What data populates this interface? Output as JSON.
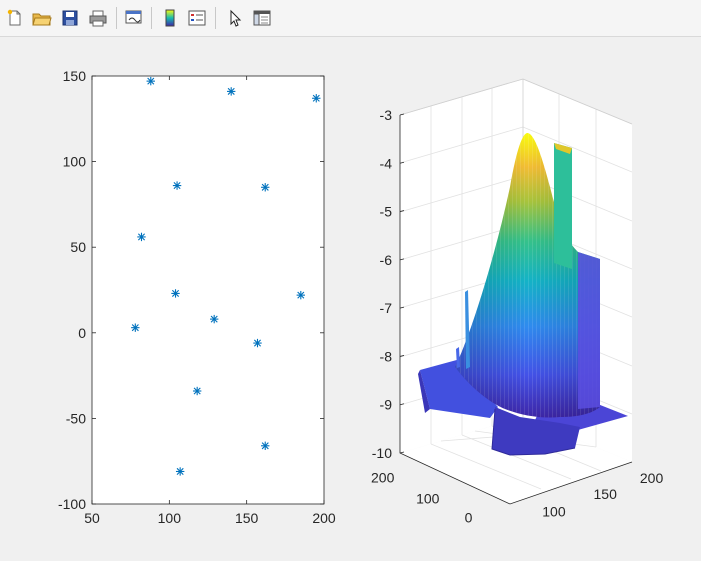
{
  "toolbar": {
    "items": [
      {
        "name": "new-figure-icon"
      },
      {
        "name": "open-file-icon"
      },
      {
        "name": "save-icon"
      },
      {
        "name": "print-icon"
      },
      {
        "name": "link-plot-icon"
      },
      {
        "name": "insert-colorbar-icon"
      },
      {
        "name": "insert-legend-icon"
      },
      {
        "name": "edit-plot-icon"
      },
      {
        "name": "property-inspector-icon"
      }
    ]
  },
  "chart_data": [
    {
      "type": "scatter",
      "marker": "asterisk",
      "color": "#0072BD",
      "xlim": [
        50,
        200
      ],
      "ylim": [
        -100,
        150
      ],
      "xticks": [
        "50",
        "100",
        "150",
        "200"
      ],
      "yticks": [
        "-100",
        "-50",
        "0",
        "50",
        "100",
        "150"
      ],
      "points": [
        {
          "x": 88,
          "y": 147
        },
        {
          "x": 140,
          "y": 141
        },
        {
          "x": 195,
          "y": 137
        },
        {
          "x": 105,
          "y": 86
        },
        {
          "x": 162,
          "y": 85
        },
        {
          "x": 82,
          "y": 56
        },
        {
          "x": 104,
          "y": 23
        },
        {
          "x": 185,
          "y": 22
        },
        {
          "x": 78,
          "y": 3
        },
        {
          "x": 129,
          "y": 8
        },
        {
          "x": 157,
          "y": -6
        },
        {
          "x": 118,
          "y": -34
        },
        {
          "x": 162,
          "y": -66
        },
        {
          "x": 107,
          "y": -81
        }
      ]
    },
    {
      "type": "surface",
      "colormap": "parula",
      "zlim": [
        -10,
        -3
      ],
      "zticks": [
        "-3",
        "-4",
        "-5",
        "-6",
        "-7",
        "-8",
        "-9",
        "-10"
      ],
      "xticks": [
        "100",
        "150",
        "200"
      ],
      "yticks": [
        "200",
        "100",
        "0"
      ],
      "grid": true
    }
  ]
}
